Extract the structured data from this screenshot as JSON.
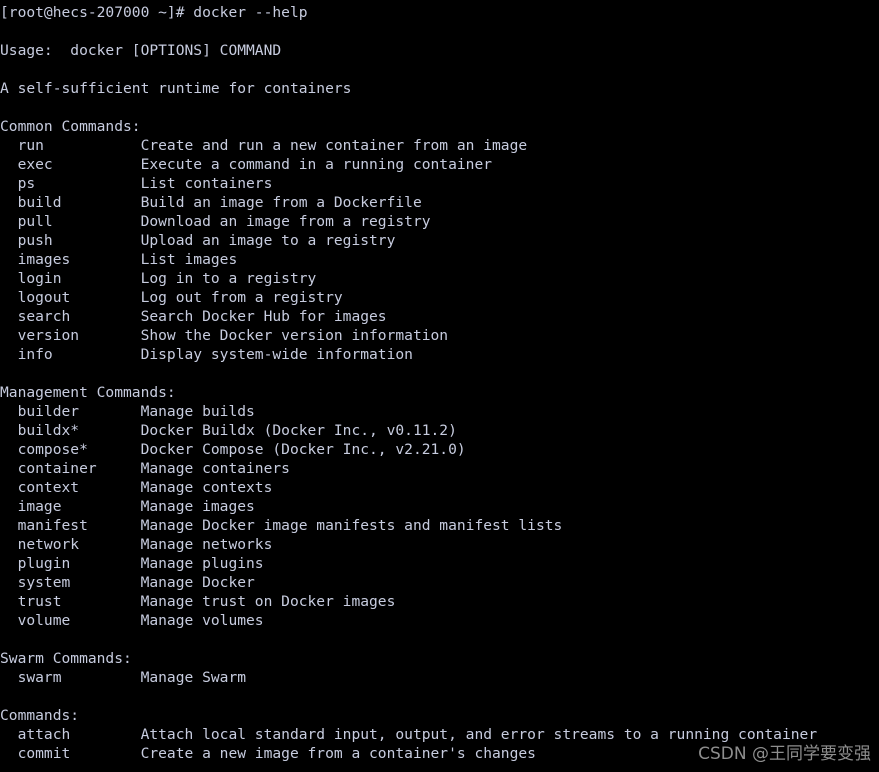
{
  "terminal": {
    "background_color": "#000000",
    "text_color": "#c7ccdf",
    "prompt_line": "[root@hecs-207000 ~]# docker --help",
    "usage_line": "Usage:  docker [OPTIONS] COMMAND",
    "tagline": "A self-sufficient runtime for containers",
    "sections": [
      {
        "heading": "Common Commands:",
        "entries": [
          {
            "command": "run",
            "description": "Create and run a new container from an image"
          },
          {
            "command": "exec",
            "description": "Execute a command in a running container"
          },
          {
            "command": "ps",
            "description": "List containers"
          },
          {
            "command": "build",
            "description": "Build an image from a Dockerfile"
          },
          {
            "command": "pull",
            "description": "Download an image from a registry"
          },
          {
            "command": "push",
            "description": "Upload an image to a registry"
          },
          {
            "command": "images",
            "description": "List images"
          },
          {
            "command": "login",
            "description": "Log in to a registry"
          },
          {
            "command": "logout",
            "description": "Log out from a registry"
          },
          {
            "command": "search",
            "description": "Search Docker Hub for images"
          },
          {
            "command": "version",
            "description": "Show the Docker version information"
          },
          {
            "command": "info",
            "description": "Display system-wide information"
          }
        ]
      },
      {
        "heading": "Management Commands:",
        "entries": [
          {
            "command": "builder",
            "description": "Manage builds"
          },
          {
            "command": "buildx*",
            "description": "Docker Buildx (Docker Inc., v0.11.2)"
          },
          {
            "command": "compose*",
            "description": "Docker Compose (Docker Inc., v2.21.0)"
          },
          {
            "command": "container",
            "description": "Manage containers"
          },
          {
            "command": "context",
            "description": "Manage contexts"
          },
          {
            "command": "image",
            "description": "Manage images"
          },
          {
            "command": "manifest",
            "description": "Manage Docker image manifests and manifest lists"
          },
          {
            "command": "network",
            "description": "Manage networks"
          },
          {
            "command": "plugin",
            "description": "Manage plugins"
          },
          {
            "command": "system",
            "description": "Manage Docker"
          },
          {
            "command": "trust",
            "description": "Manage trust on Docker images"
          },
          {
            "command": "volume",
            "description": "Manage volumes"
          }
        ]
      },
      {
        "heading": "Swarm Commands:",
        "entries": [
          {
            "command": "swarm",
            "description": "Manage Swarm"
          }
        ]
      },
      {
        "heading": "Commands:",
        "entries": [
          {
            "command": "attach",
            "description": "Attach local standard input, output, and error streams to a running container"
          },
          {
            "command": "commit",
            "description": "Create a new image from a container's changes"
          }
        ]
      }
    ]
  },
  "watermark": {
    "text": "CSDN @王同学要变强",
    "color": "#8e8e8e"
  }
}
